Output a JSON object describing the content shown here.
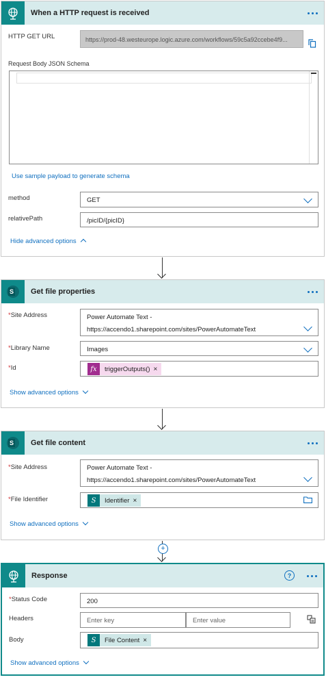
{
  "http_card": {
    "title": "When a HTTP request is received",
    "get_url_label": "HTTP GET URL",
    "get_url_value": "https://prod-48.westeurope.logic.azure.com/workflows/59c5a92ccebe4f9...",
    "schema_label": "Request Body JSON Schema",
    "sample_link": "Use sample payload to generate schema",
    "method_label": "method",
    "method_value": "GET",
    "relative_path_label": "relativePath",
    "relative_path_value": "/picID/{picID}",
    "advanced_link": "Hide advanced options"
  },
  "props_card": {
    "title": "Get file properties",
    "site_label": "Site Address",
    "site_value_line1": "Power Automate Text -",
    "site_value_line2": "https://accendo1.sharepoint.com/sites/PowerAutomateText",
    "library_label": "Library Name",
    "library_value": "Images",
    "id_label": "Id",
    "id_token": "triggerOutputs()",
    "advanced_link": "Show advanced options"
  },
  "content_card": {
    "title": "Get file content",
    "site_label": "Site Address",
    "site_value_line1": "Power Automate Text -",
    "site_value_line2": "https://accendo1.sharepoint.com/sites/PowerAutomateText",
    "file_label": "File Identifier",
    "file_token": "Identifier",
    "advanced_link": "Show advanced options"
  },
  "response_card": {
    "title": "Response",
    "status_label": "Status Code",
    "status_value": "200",
    "headers_label": "Headers",
    "key_placeholder": "Enter key",
    "value_placeholder": "Enter value",
    "body_label": "Body",
    "body_token": "File Content",
    "advanced_link": "Show advanced options"
  },
  "required_mark": "*",
  "token_remove_glyph": "×",
  "icons": [
    "globe-icon",
    "sharepoint-icon",
    "more-options-icon",
    "copy-icon",
    "chevron-down-icon",
    "chevron-up-icon",
    "function-icon",
    "folder-icon",
    "add-step-icon",
    "help-icon",
    "switch-mode-icon"
  ],
  "colors": {
    "accent": "#0f8a8a",
    "header_bg": "#d7ebec",
    "link": "#0f6fbf",
    "required": "#d13438",
    "expression_token": "#a12d8f"
  }
}
